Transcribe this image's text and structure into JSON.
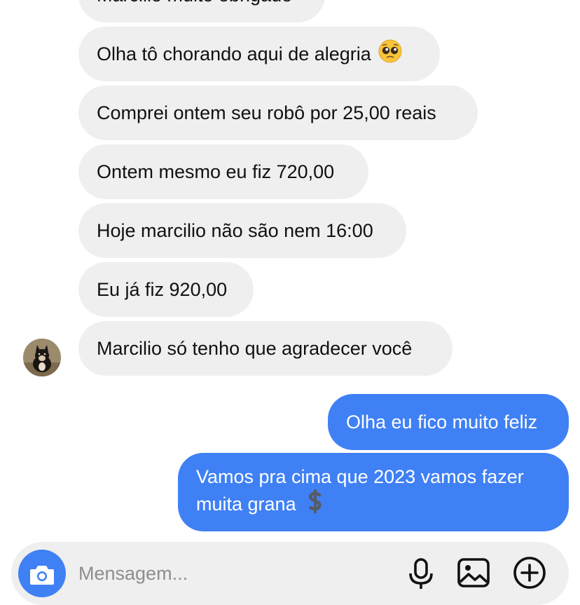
{
  "messages": {
    "partial": "Marcilio muito obrigado",
    "incoming": [
      "Olha tô chorando aqui de alegria",
      "Comprei ontem seu robô por 25,00 reais",
      "Ontem mesmo eu fiz 720,00",
      "Hoje marcilio não são nem 16:00",
      "Eu já fiz 920,00",
      "Marcilio só tenho que agradecer você"
    ],
    "outgoing": [
      "Olha eu fico muito feliz",
      "Vamos pra cima que 2023 vamos fazer",
      "muita grana"
    ]
  },
  "composer": {
    "placeholder": "Mensagem..."
  },
  "icons": {
    "emoji": "pleading-face-emoji",
    "dollar": "heavy-dollar-sign",
    "camera": "camera-icon",
    "mic": "microphone-icon",
    "gallery": "image-icon",
    "add": "plus-circle-icon"
  },
  "colors": {
    "incoming_bubble": "#efefef",
    "outgoing_bubble": "#3f80f5",
    "composer_bg": "#efefef"
  }
}
